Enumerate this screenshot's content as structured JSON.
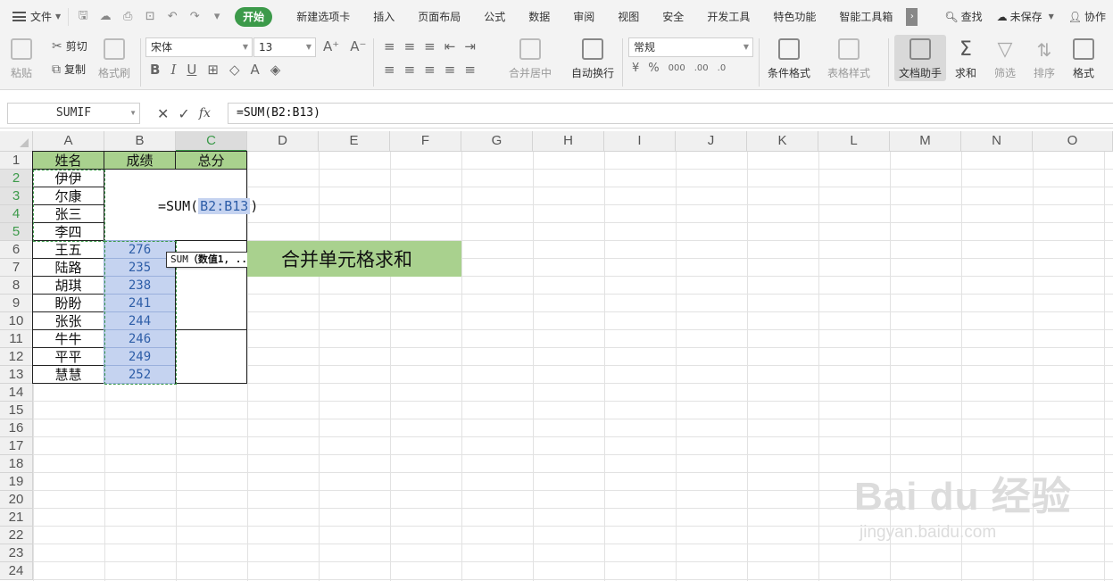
{
  "menubar": {
    "file_label": "文件",
    "tabs": [
      "开始",
      "新建选项卡",
      "插入",
      "页面布局",
      "公式",
      "数据",
      "审阅",
      "视图",
      "安全",
      "开发工具",
      "特色功能",
      "智能工具箱"
    ],
    "active_tab": "开始",
    "more": "›",
    "search_label": "查找",
    "save_label": "未保存",
    "collab_label": "协作"
  },
  "ribbon": {
    "paste_label": "粘贴",
    "cut_label": "剪切",
    "copy_label": "复制",
    "format_painter_label": "格式刷",
    "font_name": "宋体",
    "font_size": "13",
    "font_grow": "A⁺",
    "font_shrink": "A⁻",
    "bold": "B",
    "italic": "I",
    "underline": "U",
    "merge_center_label": "合并居中",
    "wrap_text_label": "自动换行",
    "number_format": "常规",
    "percent": "%",
    "thousands": "000",
    "dec_inc": ".00",
    "dec_dec": ".0",
    "conditional_format_label": "条件格式",
    "table_style_label": "表格样式",
    "doc_assistant_label": "文档助手",
    "sum_label": "求和",
    "filter_label": "筛选",
    "sort_label": "排序",
    "format_label": "格式"
  },
  "formula_bar": {
    "name_box": "SUMIF",
    "cancel": "✕",
    "confirm": "✓",
    "fx": "fx",
    "formula": "=SUM(B2:B13)"
  },
  "columns": [
    "A",
    "B",
    "C",
    "D",
    "E",
    "F",
    "G",
    "H",
    "I",
    "J",
    "K",
    "L",
    "M",
    "N",
    "O"
  ],
  "rows": [
    "1",
    "2",
    "3",
    "4",
    "5",
    "6",
    "7",
    "8",
    "9",
    "10",
    "11",
    "12",
    "13",
    "14",
    "15",
    "16",
    "17",
    "18",
    "19",
    "20",
    "21",
    "22",
    "23",
    "24"
  ],
  "sheet": {
    "headers": [
      "姓名",
      "成绩",
      "总分"
    ],
    "names": [
      "伊伊",
      "尔康",
      "张三",
      "李四",
      "王五",
      "陆路",
      "胡琪",
      "盼盼",
      "张张",
      "牛牛",
      "平平",
      "慧慧"
    ],
    "scores": [
      "276",
      "235",
      "238",
      "241",
      "244",
      "246",
      "249",
      "252"
    ],
    "editing_formula_prefix": "=SUM(",
    "editing_formula_ref": "B2:B13",
    "editing_formula_suffix": ")",
    "tooltip_func": "SUM",
    "tooltip_args": "（数值1, ...）",
    "banner_text": "合并单元格求和"
  },
  "watermark": {
    "logo": "Bai du 经验",
    "url": "jingyan.baidu.com"
  }
}
